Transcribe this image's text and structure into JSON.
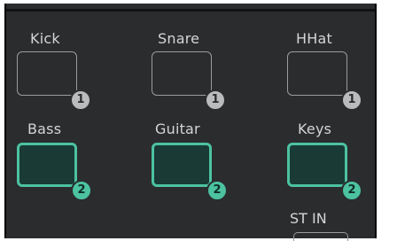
{
  "channels_row1": [
    {
      "label": "Kick",
      "badge": "1"
    },
    {
      "label": "Snare",
      "badge": "1"
    },
    {
      "label": "HHat",
      "badge": "1"
    }
  ],
  "channels_row2": [
    {
      "label": "Bass",
      "badge": "2"
    },
    {
      "label": "Guitar",
      "badge": "2"
    },
    {
      "label": "Keys",
      "badge": "2"
    }
  ],
  "stereo_input": {
    "label": "ST IN"
  },
  "colors": {
    "panel_bg": "#2a2c2e",
    "active_accent": "#4cc2a1",
    "active_fill": "#193a35",
    "inactive_border": "#9a9c9e",
    "inactive_badge": "#b9bbbd",
    "label_text": "#d4d5d6"
  }
}
